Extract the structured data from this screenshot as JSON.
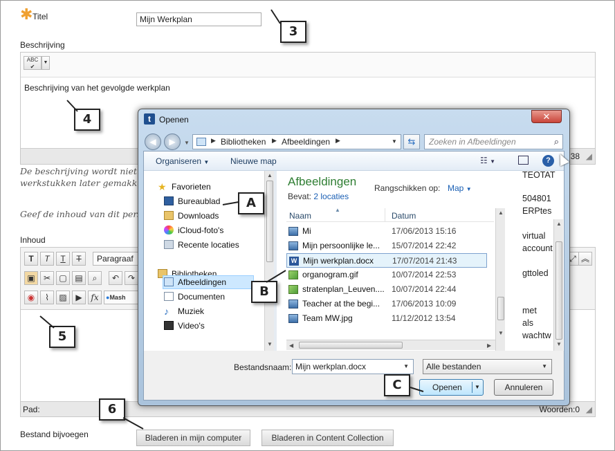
{
  "form": {
    "title_label": "Titel",
    "title_value": "Mijn Werkplan",
    "desc_label": "Beschrijving",
    "desc_text": "Beschrijving van het gevolgde werkplan",
    "desc_counter": "38",
    "note1_line1": "De beschrijving wordt niet a",
    "note1_line2": "werkstukken later gemakke",
    "note2": "Geef de inhoud van dit pers",
    "content_label": "Inhoud",
    "paragraph_label": "Paragraaf",
    "mash_label": "Mash",
    "path_label": "Pad:",
    "words_label": "Woorden:0",
    "attach_label": "Bestand bijvoegen",
    "browse_computer": "Bladeren in mijn computer",
    "browse_collection": "Bladeren in Content Collection",
    "side_text": [
      "TEOTAT",
      "504801",
      "ERPtes",
      "virtual",
      "account",
      "gttoled",
      "met",
      "als",
      "wachtw"
    ]
  },
  "callouts": [
    "3",
    "4",
    "5",
    "6",
    "A",
    "B",
    "C"
  ],
  "dialog": {
    "title": "Openen",
    "breadcrumb": [
      "Bibliotheken",
      "Afbeeldingen"
    ],
    "search_placeholder": "Zoeken in Afbeeldingen",
    "organize": "Organiseren",
    "new_folder": "Nieuwe map",
    "nav": {
      "favorites": "Favorieten",
      "fav_items": [
        "Bureaublad",
        "Downloads",
        "iCloud-foto's",
        "Recente locaties"
      ],
      "libraries": "Bibliotheken",
      "lib_items": [
        "Afbeeldingen",
        "Documenten",
        "Muziek",
        "Video's"
      ]
    },
    "folder_title": "Afbeeldingen",
    "contains_label": "Bevat:",
    "contains_value": "2 locaties",
    "arrange_label": "Rangschikken op:",
    "arrange_value": "Map",
    "col_name": "Naam",
    "col_date": "Datum",
    "files": [
      {
        "name": "Mi",
        "date": "17/06/2013 15:16",
        "type": "image"
      },
      {
        "name": "Mijn persoonlijke le...",
        "date": "15/07/2014 22:42",
        "type": "image"
      },
      {
        "name": "Mijn werkplan.docx",
        "date": "17/07/2014 21:43",
        "type": "word"
      },
      {
        "name": "organogram.gif",
        "date": "10/07/2014 22:53",
        "type": "gif"
      },
      {
        "name": "stratenplan_Leuven....",
        "date": "10/07/2014 22:44",
        "type": "gif"
      },
      {
        "name": "Teacher at the begi...",
        "date": "17/06/2013 10:09",
        "type": "image"
      },
      {
        "name": "Team MW.jpg",
        "date": "11/12/2012 13:54",
        "type": "image"
      }
    ],
    "filename_label": "Bestandsnaam:",
    "filename_value": "Mijn werkplan.docx",
    "filter_value": "Alle bestanden",
    "open_btn": "Openen",
    "cancel_btn": "Annuleren"
  },
  "colors": {
    "accent_blue": "#1a5fb4",
    "folder_title_green": "#2e7d32",
    "selection": "#cde8ff",
    "close_red": "#c9453a"
  }
}
